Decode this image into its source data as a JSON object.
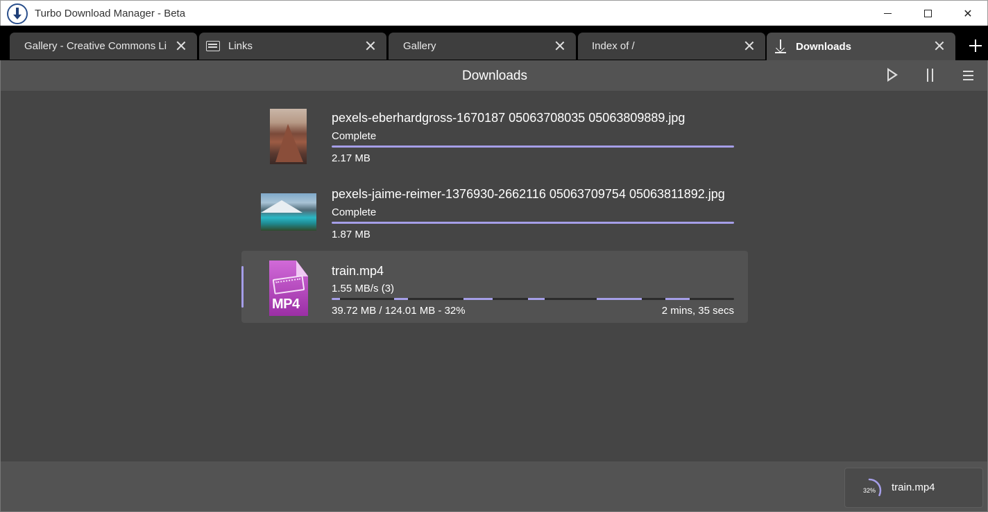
{
  "window": {
    "title": "Turbo Download Manager - Beta"
  },
  "tabs": [
    {
      "label": "Gallery - Creative Commons Li",
      "icon": "none",
      "active": false
    },
    {
      "label": "Links",
      "icon": "links-icon",
      "active": false
    },
    {
      "label": "Gallery",
      "icon": "none",
      "active": false
    },
    {
      "label": "Index of /",
      "icon": "none",
      "active": false
    },
    {
      "label": "Downloads",
      "icon": "download-icon",
      "active": true
    }
  ],
  "toolbar": {
    "title": "Downloads"
  },
  "downloads": [
    {
      "filename": "pexels-eberhardgross-1670187 05063708035 05063809889.jpg",
      "status": "Complete",
      "size": "2.17 MB",
      "progress": 1.0,
      "thumbnail": "mountain-image"
    },
    {
      "filename": "pexels-jaime-reimer-1376930-2662116 05063709754 05063811892.jpg",
      "status": "Complete",
      "size": "1.87 MB",
      "progress": 1.0,
      "thumbnail": "lake-image"
    },
    {
      "filename": "train.mp4",
      "status": "1.55 MB/s (3)",
      "size": "39.72 MB / 124.01 MB - 32%",
      "eta": "2 mins, 35 secs",
      "progress": 0.32,
      "thumbnail": "mp4-file-icon",
      "thumbnail_text": "MP4"
    }
  ],
  "bottom_bar": {
    "active_download": {
      "percent_label": "32%",
      "percent": 32,
      "name": "train.mp4"
    }
  },
  "colors": {
    "accent": "#a59ee8",
    "background": "#454545",
    "toolbar": "#535353"
  }
}
